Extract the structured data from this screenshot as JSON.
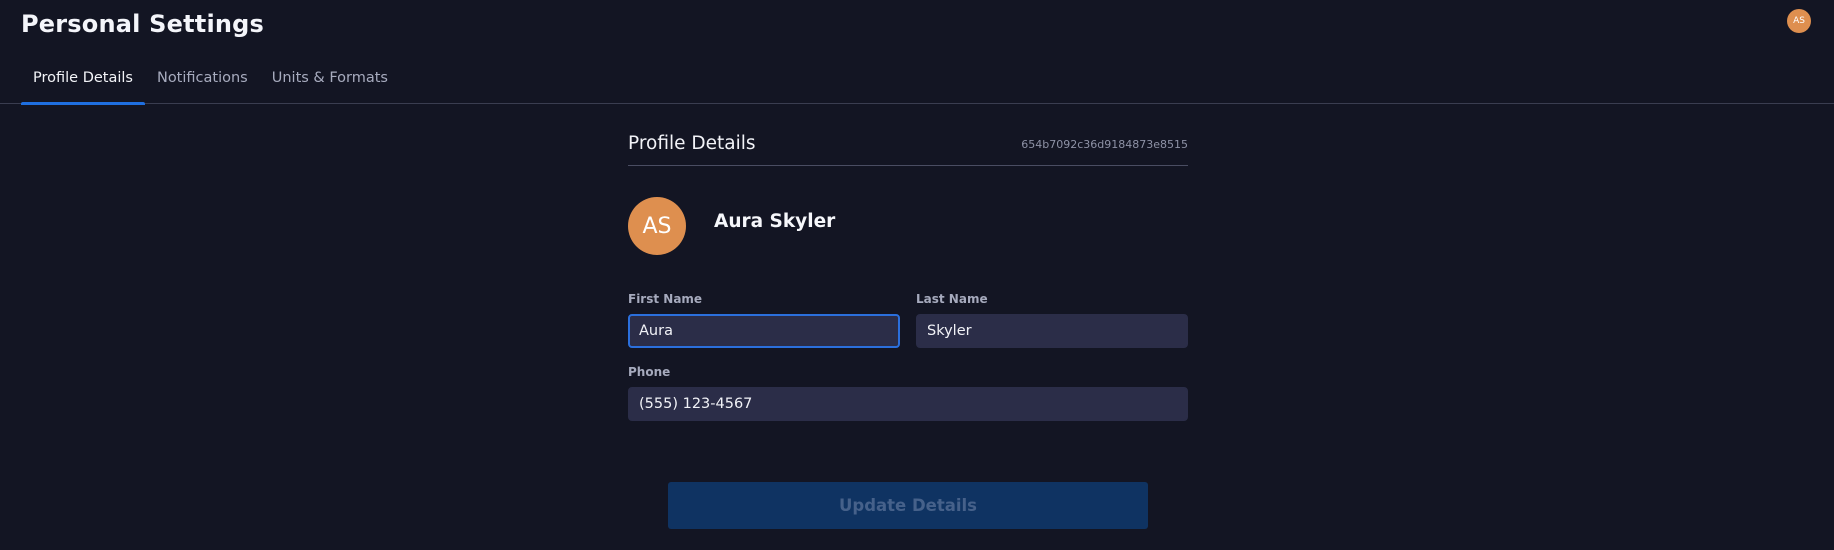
{
  "header": {
    "title": "Personal Settings",
    "avatar_initials": "AS"
  },
  "tabs": [
    {
      "label": "Profile Details",
      "active": true
    },
    {
      "label": "Notifications",
      "active": false
    },
    {
      "label": "Units & Formats",
      "active": false
    }
  ],
  "panel": {
    "title": "Profile Details",
    "record_id": "654b7092c36d9184873e8515"
  },
  "profile": {
    "initials": "AS",
    "full_name": "Aura Skyler"
  },
  "form": {
    "first_name_label": "First Name",
    "first_name_value": "Aura",
    "last_name_label": "Last Name",
    "last_name_value": "Skyler",
    "phone_label": "Phone",
    "phone_value": "(555) 123-4567"
  },
  "actions": {
    "update_label": "Update Details"
  },
  "colors": {
    "background": "#131523",
    "accent": "#1f6fe0",
    "avatar": "#de8f4f",
    "input_bg": "#2b2d48",
    "button_disabled_bg": "#0f3362"
  }
}
